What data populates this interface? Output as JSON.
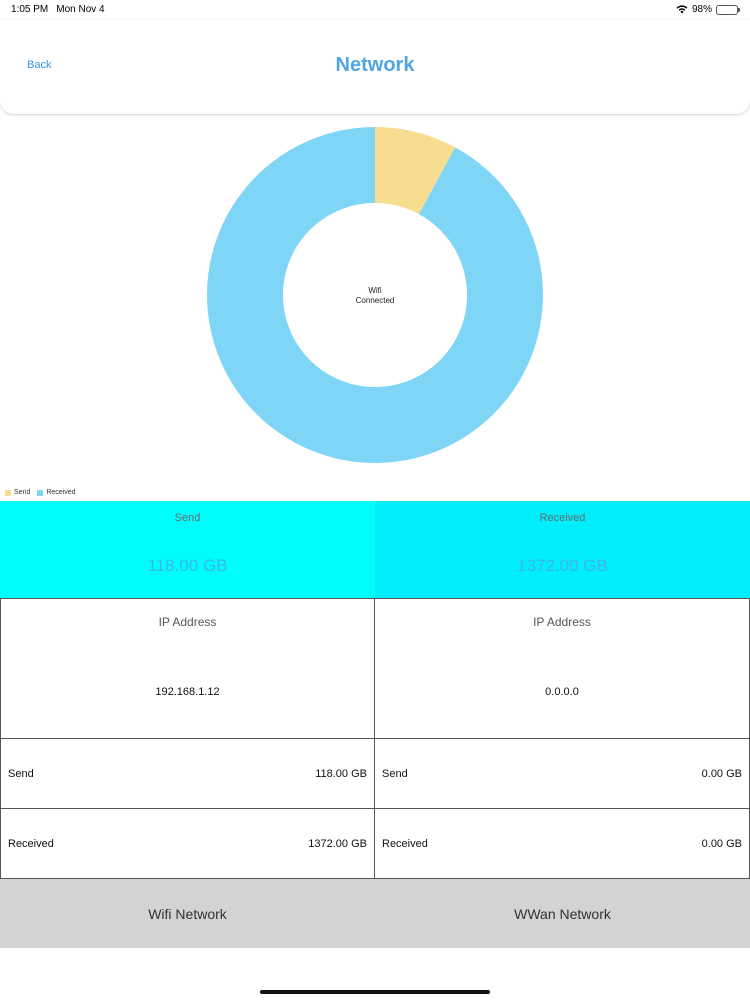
{
  "status": {
    "time": "1:05 PM",
    "date": "Mon Nov 4",
    "battery_text": "98%",
    "battery_level": 0.98
  },
  "nav": {
    "back_label": "Back",
    "title": "Network"
  },
  "chart_data": {
    "type": "pie",
    "categories": [
      "Send",
      "Received"
    ],
    "values": [
      118.0,
      1372.0
    ],
    "colors": [
      "#f7dd90",
      "#7fd5f6"
    ],
    "center_text": [
      "Wifi",
      "Connected"
    ],
    "legend_placement": "bottom-left"
  },
  "totals": {
    "send_label": "Send",
    "send_value": "118.00 GB",
    "received_label": "Received",
    "received_value": "1372.00 GB"
  },
  "wifi": {
    "ip_label": "IP Address",
    "ip_value": "192.168.1.12",
    "send_label": "Send",
    "send_value": "118.00 GB",
    "received_label": "Received",
    "received_value": "1372.00 GB"
  },
  "wwan": {
    "ip_label": "IP Address",
    "ip_value": "0.0.0.0",
    "send_label": "Send",
    "send_value": "0.00 GB",
    "received_label": "Received",
    "received_value": "0.00 GB"
  },
  "tabs": [
    {
      "label": "Wifi Network"
    },
    {
      "label": "WWan Network"
    }
  ]
}
